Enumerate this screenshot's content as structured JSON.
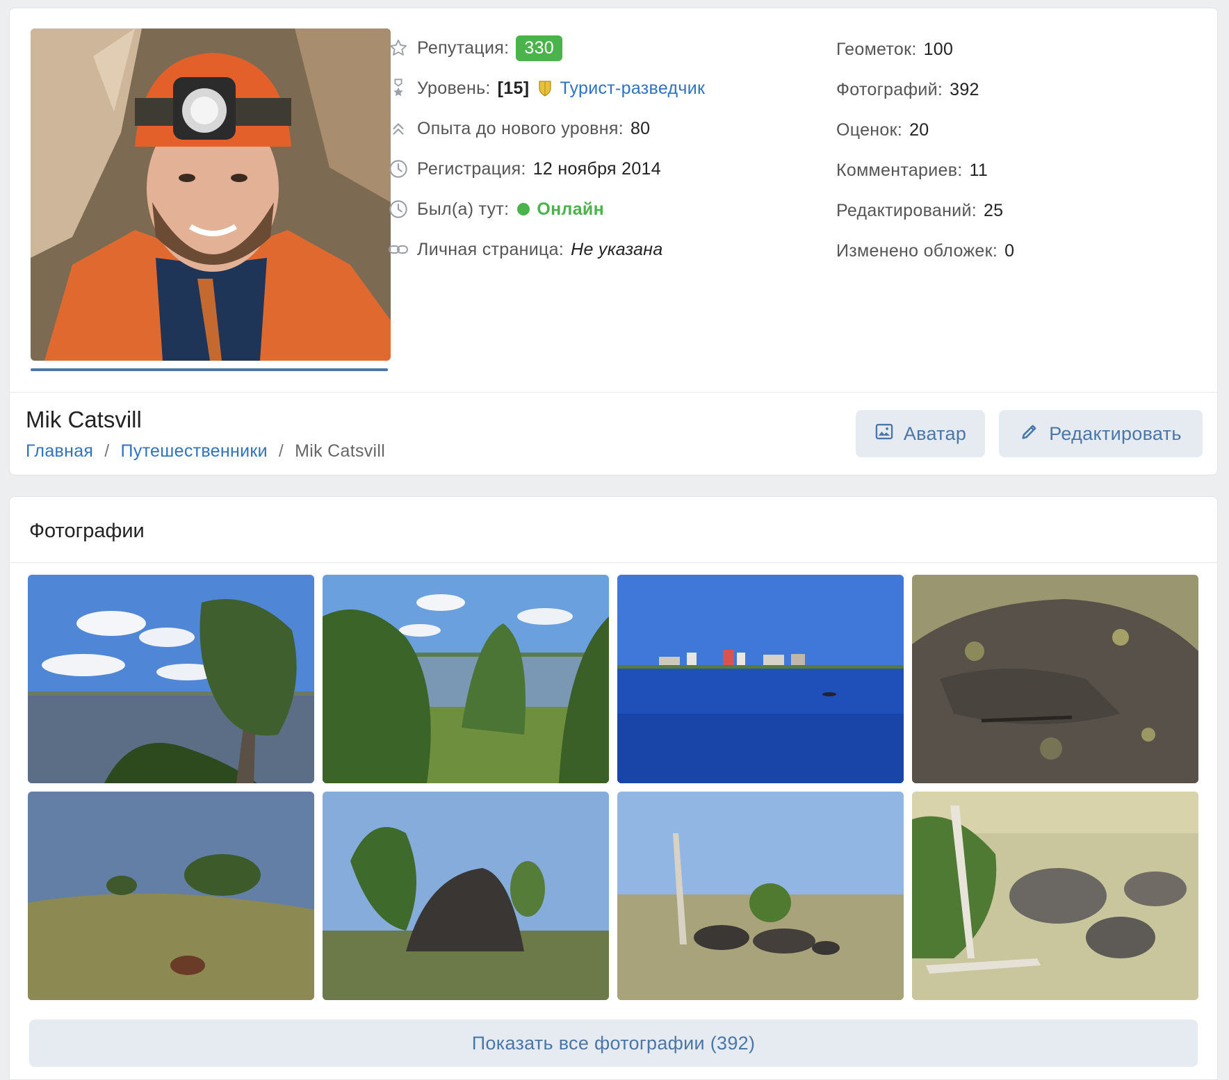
{
  "profile": {
    "stats_left": {
      "reputation_label": "Репутация:",
      "reputation_value": "330",
      "level_label": "Уровень:",
      "level_value": "[15]",
      "level_title": "Турист-разведчик",
      "exp_label": "Опыта до нового уровня:",
      "exp_value": "80",
      "registration_label": "Регистрация:",
      "registration_value": "12 ноября 2014",
      "last_seen_label": "Был(а) тут:",
      "last_seen_value": "Онлайн",
      "homepage_label": "Личная страница:",
      "homepage_value": "Не указана"
    },
    "stats_right": [
      {
        "label": "Геометок:",
        "value": "100"
      },
      {
        "label": "Фотографий:",
        "value": "392"
      },
      {
        "label": "Оценок:",
        "value": "20"
      },
      {
        "label": "Комментариев:",
        "value": "11"
      },
      {
        "label": "Редактирований:",
        "value": "25"
      },
      {
        "label": "Изменено обложек:",
        "value": "0"
      }
    ],
    "name": "Mik Catsvill",
    "breadcrumbs": [
      "Главная",
      "Путешественники",
      "Mik Catsvill"
    ],
    "buttons": {
      "avatar": "Аватар",
      "edit": "Редактировать"
    }
  },
  "photos": {
    "title": "Фотографии",
    "show_all": "Показать все фотографии (392)"
  },
  "colors": {
    "accent": "#4a76a8",
    "link": "#2f72c2",
    "online": "#4bb34b",
    "button_bg": "#e5ebf1"
  }
}
